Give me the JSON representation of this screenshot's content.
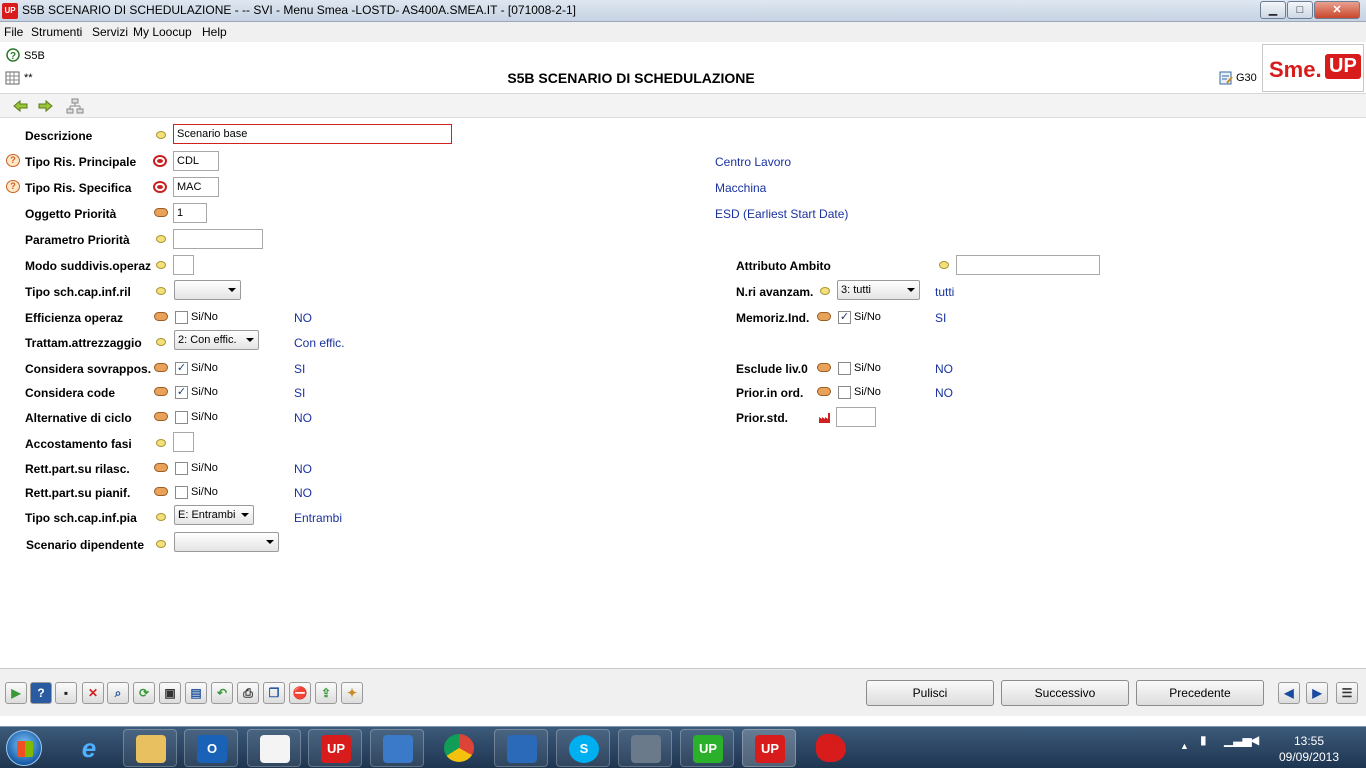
{
  "window": {
    "title": "S5B SCENARIO DI SCHEDULAZIONE -  -- SVI - Menu Smea -LOSTD- AS400A.SMEA.IT - [071008-2-1]",
    "app_logo": "UP",
    "min_label": "▁",
    "max_label": "□",
    "close_label": "✕"
  },
  "menu": [
    "File",
    "Strumenti",
    "Servizi",
    "My Loocup",
    "Help"
  ],
  "header": {
    "code": "S5B",
    "stars": "**",
    "title": "S5B SCENARIO DI SCHEDULAZIONE",
    "right_code": "G30",
    "logo_sme": "Sme.",
    "logo_up": "UP"
  },
  "form": {
    "descrizione": {
      "label": "Descrizione",
      "value": "Scenario base"
    },
    "tipo_ris_principale": {
      "label": "Tipo Ris. Principale",
      "value": "CDL",
      "desc": "Centro Lavoro"
    },
    "tipo_ris_specifica": {
      "label": "Tipo Ris. Specifica",
      "value": "MAC",
      "desc": "Macchina"
    },
    "oggetto_priorita": {
      "label": "Oggetto Priorità",
      "value": "1",
      "desc": "ESD (Earliest Start Date)"
    },
    "parametro_priorita": {
      "label": "Parametro Priorità",
      "value": ""
    },
    "modo_suddivis": {
      "label": "Modo suddivis.operaz",
      "value": ""
    },
    "attributo_ambito": {
      "label": "Attributo Ambito",
      "value": ""
    },
    "tipo_sch_cap_inf_ril": {
      "label": "Tipo sch.cap.inf.ril",
      "value": ""
    },
    "nri_avanzam": {
      "label": "N.ri avanzam.",
      "value": "3: tutti",
      "desc": "tutti"
    },
    "efficienza_operaz": {
      "label": "Efficienza operaz",
      "check_label": "Si/No",
      "checked": false,
      "desc": "NO"
    },
    "memoriz_ind": {
      "label": "Memoriz.Ind.",
      "check_label": "Si/No",
      "checked": true,
      "desc": "SI"
    },
    "trattam_attrezzaggio": {
      "label": "Trattam.attrezzaggio",
      "value": "2: Con effic.",
      "desc": "Con effic."
    },
    "considera_sovrappos": {
      "label": "Considera sovrappos.",
      "check_label": "Si/No",
      "checked": true,
      "desc": "SI"
    },
    "esclude_liv0": {
      "label": "Esclude liv.0",
      "check_label": "Si/No",
      "checked": false,
      "desc": "NO"
    },
    "considera_code": {
      "label": "Considera code",
      "check_label": "Si/No",
      "checked": true,
      "desc": "SI"
    },
    "prior_in_ord": {
      "label": "Prior.in ord.",
      "check_label": "Si/No",
      "checked": false,
      "desc": "NO"
    },
    "alternative_ciclo": {
      "label": "Alternative di ciclo",
      "check_label": "Si/No",
      "checked": false,
      "desc": "NO"
    },
    "prior_std": {
      "label": "Prior.std.",
      "value": ""
    },
    "accostamento_fasi": {
      "label": "Accostamento fasi",
      "value": ""
    },
    "rett_part_rilasc": {
      "label": "Rett.part.su rilasc.",
      "check_label": "Si/No",
      "checked": false,
      "desc": "NO"
    },
    "rett_part_pianif": {
      "label": "Rett.part.su pianif.",
      "check_label": "Si/No",
      "checked": false,
      "desc": "NO"
    },
    "tipo_sch_cap_inf_pia": {
      "label": "Tipo sch.cap.inf.pia",
      "value": "E: Entrambi",
      "desc": "Entrambi"
    },
    "scenario_dipendente": {
      "label": "Scenario dipendente",
      "value": ""
    }
  },
  "check_mark": "✓",
  "bottom": {
    "buttons": [
      "Pulisci",
      "Successivo",
      "Precedente"
    ]
  },
  "taskbar": {
    "time": "13:55",
    "date": "09/09/2013",
    "apps": [
      "e",
      "O",
      "UP",
      "S",
      "UP",
      "UP"
    ]
  },
  "colors": {
    "brand_red": "#d81c1c",
    "value_blue": "#1a32a0"
  }
}
